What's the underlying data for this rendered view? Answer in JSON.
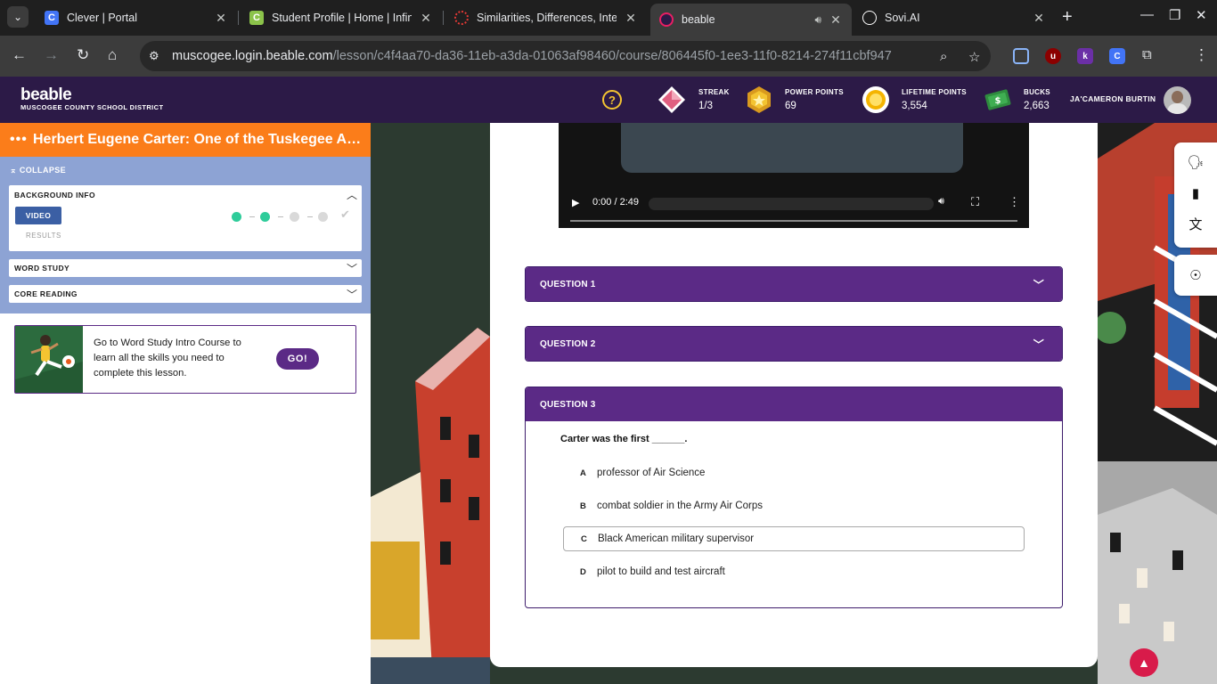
{
  "browser": {
    "tabs": [
      {
        "title": "Clever | Portal",
        "favicon_letter": "C",
        "favicon_color": "#4274f6"
      },
      {
        "title": "Student Profile | Home | Infini",
        "favicon_letter": "C",
        "favicon_color": "#8bc34a"
      },
      {
        "title": "Similarities, Differences, Intere",
        "favicon_letter": "",
        "favicon_color": "#e53935"
      },
      {
        "title": "beable",
        "favicon_letter": "",
        "favicon_color": "#e91e63"
      },
      {
        "title": "Sovi.AI",
        "favicon_letter": "",
        "favicon_color": "#ffffff"
      }
    ],
    "url_host": "muscogee.login.beable.com",
    "url_path": "/lesson/c4f4aa70-da36-11eb-a3da-01063af98460/course/806445f0-1ee3-11f0-8214-274f11cbf947"
  },
  "header": {
    "logo": "beable",
    "district": "MUSCOGEE COUNTY SCHOOL DISTRICT",
    "help": "?",
    "stats": [
      {
        "label": "STREAK",
        "value": "1/3"
      },
      {
        "label": "POWER POINTS",
        "value": "69"
      },
      {
        "label": "LIFETIME POINTS",
        "value": "3,554"
      },
      {
        "label": "BUCKS",
        "value": "2,663"
      }
    ],
    "username": "JA'CAMERON BURTIN"
  },
  "sidebar": {
    "lesson_title": "Herbert Eugene Carter: One of the Tuskegee Airmen",
    "collapse": "COLLAPSE",
    "sections": [
      {
        "title": "BACKGROUND INFO",
        "expanded": true
      },
      {
        "title": "WORD STUDY",
        "expanded": false
      },
      {
        "title": "CORE READING",
        "expanded": false
      }
    ],
    "video_button": "VIDEO",
    "results_link": "RESULTS",
    "progress": {
      "completed_steps": 2,
      "total_steps": 4
    },
    "promo": {
      "text": "Go to Word Study Intro Course to learn all the skills you need to complete this lesson.",
      "button": "GO!"
    }
  },
  "video": {
    "time": "0:00 / 2:49"
  },
  "questions": [
    {
      "title": "QUESTION 1",
      "expanded": false
    },
    {
      "title": "QUESTION 2",
      "expanded": false
    },
    {
      "title": "QUESTION 3",
      "expanded": true,
      "prompt": "Carter was the first ______.",
      "options": [
        {
          "letter": "A",
          "text": "professor of Air Science"
        },
        {
          "letter": "B",
          "text": "combat soldier in the Army Air Corps"
        },
        {
          "letter": "C",
          "text": "Black American military supervisor"
        },
        {
          "letter": "D",
          "text": "pilot to build and test aircraft"
        }
      ],
      "selected_option": "C"
    }
  ],
  "colors": {
    "header_bg": "#2c1a47",
    "lesson_bar": "#fb7d1a",
    "accordion_bg": "#8da3d4",
    "question_purple": "#5b2a86",
    "progress_green": "#2ecc9a",
    "scroll_button": "#d81b4a"
  }
}
